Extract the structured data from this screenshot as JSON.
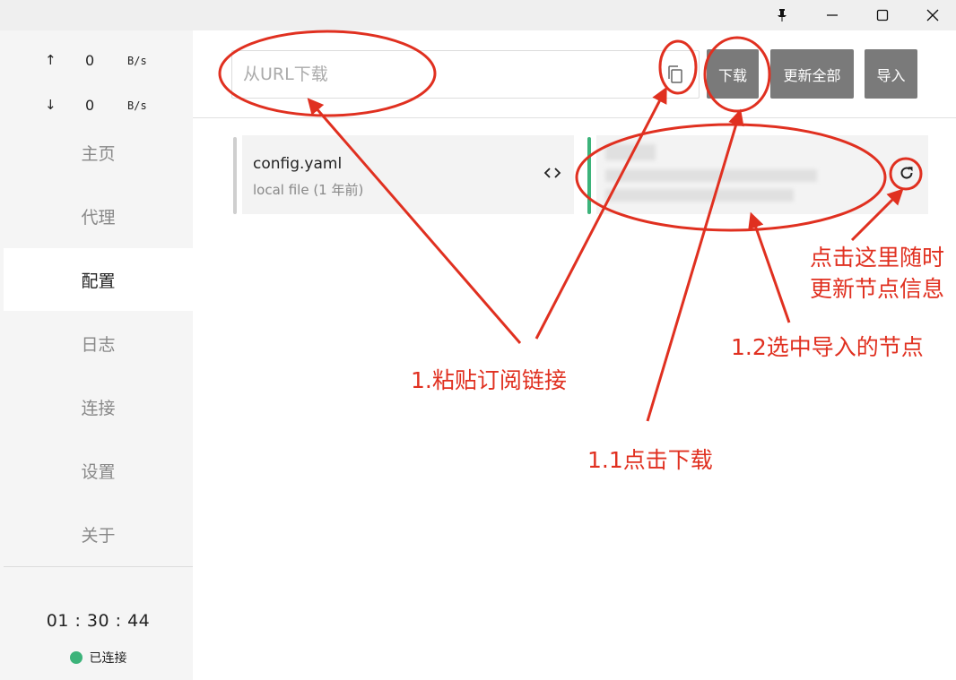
{
  "sidebar": {
    "upload": {
      "arrow": "↑",
      "value": "0",
      "unit": "B/s"
    },
    "download": {
      "arrow": "↓",
      "value": "0",
      "unit": "B/s"
    },
    "nav": [
      {
        "label": "主页"
      },
      {
        "label": "代理"
      },
      {
        "label": "配置"
      },
      {
        "label": "日志"
      },
      {
        "label": "连接"
      },
      {
        "label": "设置"
      },
      {
        "label": "关于"
      }
    ],
    "active_index": 2,
    "timer": "01 : 30 : 44",
    "status": "已连接",
    "status_color": "#3cb37a"
  },
  "toolbar": {
    "url_placeholder": "从URL下载",
    "paste_icon": "copy-icon",
    "download_label": "下载",
    "update_all_label": "更新全部",
    "import_label": "导入"
  },
  "profiles": [
    {
      "name": "config.yaml",
      "source": "local file (1 年前)",
      "icon": "code-icon",
      "bar_color": "#cfcfcf"
    },
    {
      "name": "",
      "source": "",
      "icon": "refresh-icon",
      "bar_color": "#3cb37a",
      "blurred": true
    }
  ],
  "annotations": {
    "paste": "1.粘贴订阅链接",
    "download": "1.1点击下载",
    "select": "1.2选中导入的节点",
    "refresh_line1": "点击这里随时",
    "refresh_line2": "更新节点信息",
    "color": "#e03020"
  }
}
